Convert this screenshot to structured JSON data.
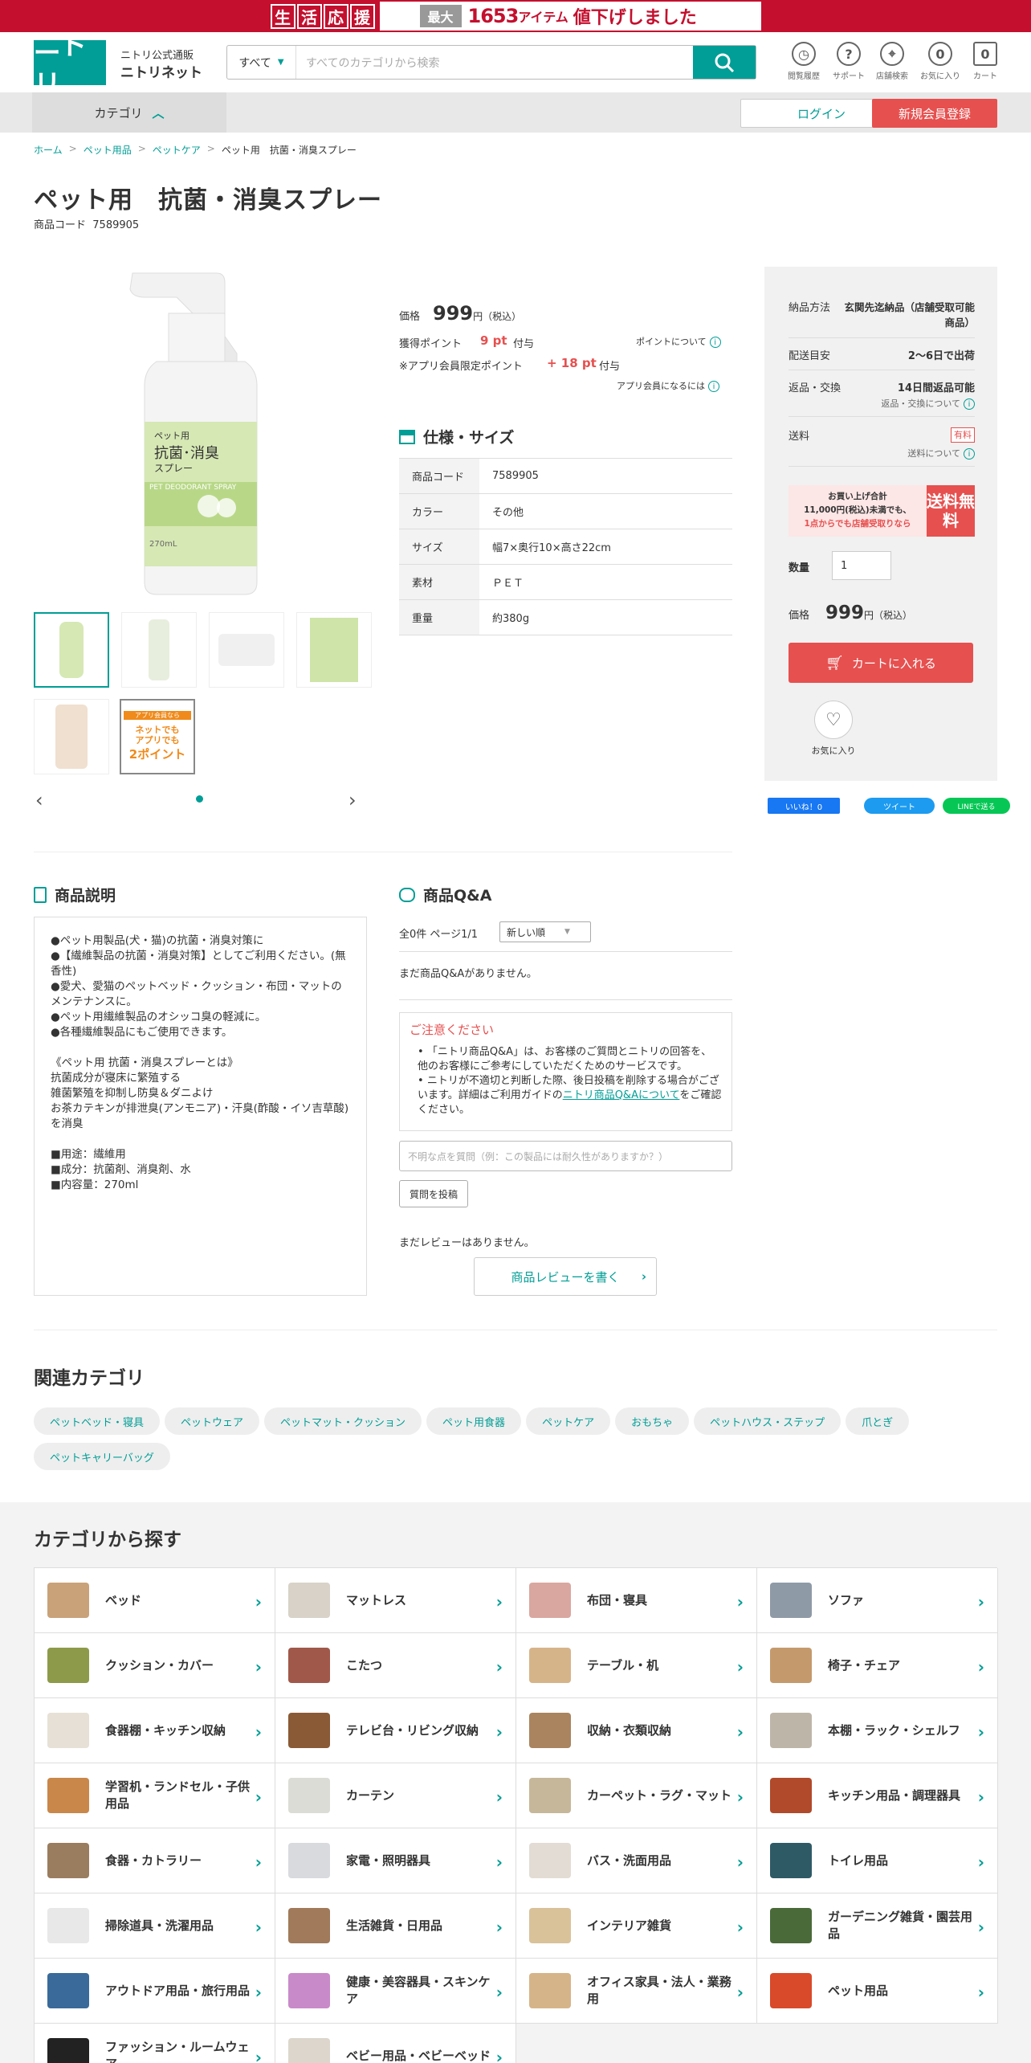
{
  "banner": {
    "kanji": [
      "生",
      "活",
      "応",
      "援"
    ],
    "max": "最大",
    "count": "1653",
    "items": "アイテム",
    "down": "値下げしました"
  },
  "header": {
    "logo": "ニトリ",
    "sub": "ニトリ公式通販",
    "name": "ニトリネット",
    "search_scope": "すべて",
    "search_placeholder": "すべてのカテゴリから検索",
    "icons": [
      {
        "label": "閲覧履歴",
        "name": "history-icon",
        "glyph": "◷"
      },
      {
        "label": "サポート",
        "name": "help-icon",
        "glyph": "?"
      },
      {
        "label": "店舗検索",
        "name": "store-pin-icon",
        "glyph": "⌖"
      },
      {
        "label": "お気に入り",
        "name": "heart-icon",
        "glyph": "0"
      },
      {
        "label": "カート",
        "name": "cart-icon",
        "glyph": "0"
      }
    ]
  },
  "nav": {
    "category": "カテゴリ",
    "login": "ログイン",
    "register": "新規会員登録"
  },
  "breadcrumb": [
    "ホーム",
    "ペット用品",
    "ペットケア",
    "ペット用　抗菌・消臭スプレー"
  ],
  "product": {
    "title": "ペット用　抗菌・消臭スプレー",
    "code_label": "商品コード",
    "code": "7589905",
    "price_label": "価格",
    "price": "999",
    "yen": "円（税込）",
    "points_label": "獲得ポイント",
    "points": "9 pt",
    "points_suffix": "付与",
    "points_about": "ポイントについて",
    "app_label": "※アプリ会員限定ポイント",
    "app_points": "+ 18 pt",
    "app_suffix": "付与",
    "app_join": "アプリ会員になるには",
    "spec_title": "仕様・サイズ",
    "specs": [
      [
        "商品コード",
        "7589905"
      ],
      [
        "カラー",
        "その他"
      ],
      [
        "サイズ",
        "幅7×奥行10×高さ22cm"
      ],
      [
        "素材",
        "ＰＥＴ"
      ],
      [
        "重量",
        "約380g"
      ]
    ],
    "bottle_label_small": "ペット用",
    "bottle_label_big": "抗菌･消臭",
    "bottle_label_3": "スプレー",
    "bottle_en": "PET DEODORANT SPRAY",
    "bottle_ml": "270mL",
    "badge_top": "アプリ会員なら",
    "badge_mid": "ネットでも\nアプリでも",
    "badge_bottom": "2ポイント"
  },
  "delivery": {
    "method_label": "納品方法",
    "method": "玄関先迄納品（店舗受取可能商品）",
    "eta_label": "配送目安",
    "eta": "2～6日で出荷",
    "return_label": "返品・交換",
    "return": "14日間返品可能",
    "return_about": "返品・交換について",
    "ship_label": "送料",
    "ship_badge": "有料",
    "ship_about": "送料について",
    "free_1": "お買い上げ合計",
    "free_2": "11,000円(税込)未満でも、",
    "free_3": "1点からでも店舗受取りなら",
    "free_big": "送料無料",
    "qty_label": "数量",
    "qty": "1",
    "price_label": "価格",
    "price": "999",
    "yen": "円（税込）",
    "cart": "カートに入れる",
    "fav": "お気に入り"
  },
  "social": {
    "like": "いいね！0",
    "tweet": "ツイート",
    "line": "LINEで送る"
  },
  "description": {
    "title": "商品説明",
    "lines": [
      "●ペット用製品(犬・猫)の抗菌・消臭対策に",
      "●【繊維製品の抗菌・消臭対策】としてご利用ください。(無香性)",
      "●愛犬、愛猫のペットベッド・クッション・布団・マットのメンテナンスに。",
      "●ペット用繊維製品のオシッコ臭の軽減に。",
      "●各種繊維製品にもご使用できます。",
      "",
      "《ペット用 抗菌・消臭スプレーとは》",
      "抗菌成分が寝床に繁殖する",
      "雑菌繁殖を抑制し防臭＆ダニよけ",
      "お茶カテキンが排泄臭(アンモニア)・汗臭(酢酸・イソ吉草酸)を消臭",
      "",
      "■用途：繊維用",
      "■成分：抗菌剤、消臭剤、水",
      "■内容量：270ml"
    ]
  },
  "qa": {
    "title": "商品Q&A",
    "count": "全0件 ページ1/1",
    "sort": "新しい順",
    "empty": "まだ商品Q&Aがありません。",
    "caution_title": "ご注意ください",
    "caution_1": "「ニトリ商品Q&A」は、お客様のご質問とニトリの回答を、他のお客様にご参考にしていただくためのサービスです。",
    "caution_2a": "ニトリが不適切と判断した際、後日投稿を削除する場合がございます。詳細はご利用ガイドの",
    "caution_link": "ニトリ商品Q&Aについて",
    "caution_2b": "をご確認ください。",
    "input_placeholder": "不明な点を質問（例：この製品には耐久性がありますか？）",
    "post": "質問を投稿",
    "no_review": "まだレビューはありません。",
    "write_review": "商品レビューを書く"
  },
  "related": {
    "title": "関連カテゴリ",
    "tags": [
      "ペットベッド・寝具",
      "ペットウェア",
      "ペットマット・クッション",
      "ペット用食器",
      "ペットケア",
      "おもちゃ",
      "ペットハウス・ステップ",
      "爪とぎ",
      "ペットキャリーバッグ"
    ]
  },
  "categories": {
    "title": "カテゴリから探す",
    "items": [
      {
        "label": "ベッド",
        "color": "#c9a27a"
      },
      {
        "label": "マットレス",
        "color": "#d8d2c8"
      },
      {
        "label": "布団・寝具",
        "color": "#d9a7a0"
      },
      {
        "label": "ソファ",
        "color": "#8e9aa6"
      },
      {
        "label": "クッション・カバー",
        "color": "#8d9a4a"
      },
      {
        "label": "こたつ",
        "color": "#a0584a"
      },
      {
        "label": "テーブル・机",
        "color": "#d6b48a"
      },
      {
        "label": "椅子・チェア",
        "color": "#c49a6c"
      },
      {
        "label": "食器棚・キッチン収納",
        "color": "#e6e0d6"
      },
      {
        "label": "テレビ台・リビング収納",
        "color": "#8a5a36"
      },
      {
        "label": "収納・衣類収納",
        "color": "#a9845f"
      },
      {
        "label": "本棚・ラック・シェルフ",
        "color": "#bdb5a8"
      },
      {
        "label": "学習机・ランドセル・子供用品",
        "color": "#c9874a"
      },
      {
        "label": "カーテン",
        "color": "#dcdcd6"
      },
      {
        "label": "カーペット・ラグ・マット",
        "color": "#c7b79a"
      },
      {
        "label": "キッチン用品・調理器具",
        "color": "#b04a2a"
      },
      {
        "label": "食器・カトラリー",
        "color": "#9a7c5e"
      },
      {
        "label": "家電・照明器具",
        "color": "#d8dade"
      },
      {
        "label": "バス・洗面用品",
        "color": "#e2dcd4"
      },
      {
        "label": "トイレ用品",
        "color": "#2e5a66"
      },
      {
        "label": "掃除道具・洗濯用品",
        "color": "#e8e8e8"
      },
      {
        "label": "生活雑貨・日用品",
        "color": "#a07a5a"
      },
      {
        "label": "インテリア雑貨",
        "color": "#d9c29a"
      },
      {
        "label": "ガーデニング雑貨・園芸用品",
        "color": "#4a6a3a"
      },
      {
        "label": "アウトドア用品・旅行用品",
        "color": "#3a6a9a"
      },
      {
        "label": "健康・美容器具・スキンケア",
        "color": "#c98ac9"
      },
      {
        "label": "オフィス家具・法人・業務用",
        "color": "#d6b48a"
      },
      {
        "label": "ペット用品",
        "color": "#d84a2a"
      },
      {
        "label": "ファッション・ルームウェア",
        "color": "#222222"
      },
      {
        "label": "ベビー用品・ベビーベッド",
        "color": "#dcd6cc"
      }
    ]
  },
  "colors": {
    "teal": "#009e96",
    "red": "#e6504f",
    "banner": "#c40f2e"
  }
}
